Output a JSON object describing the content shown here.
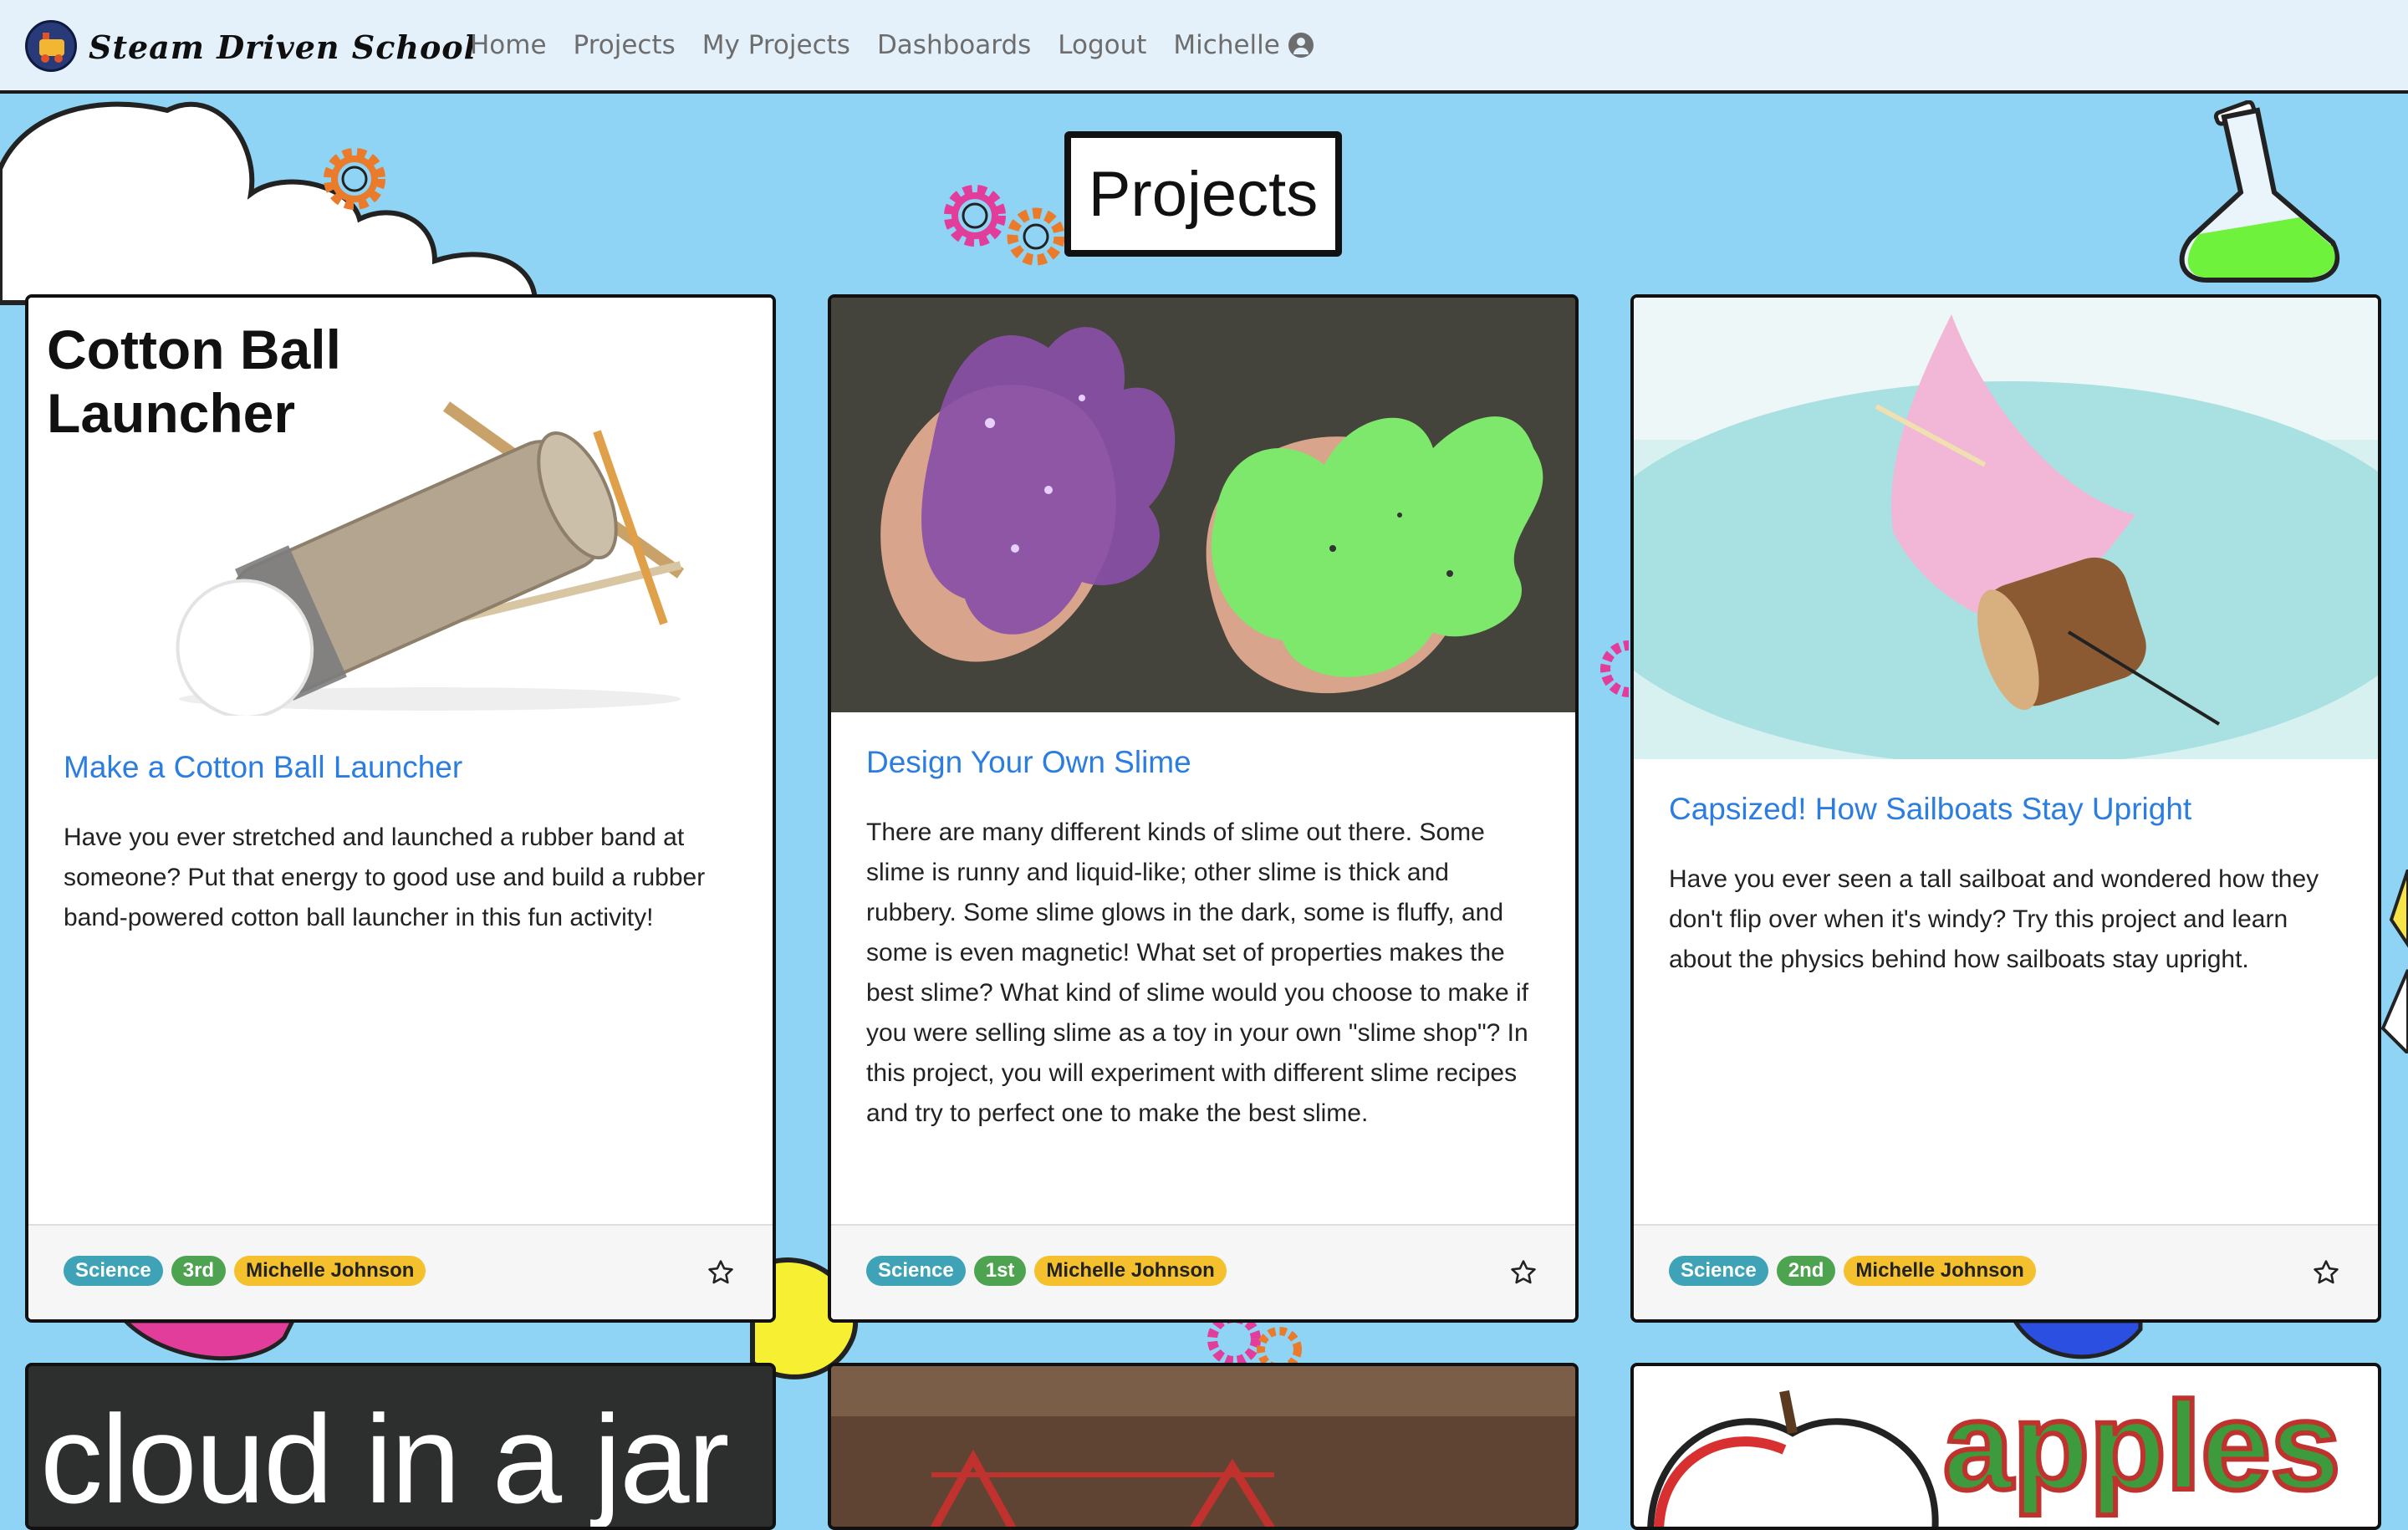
{
  "navbar": {
    "brand": "Steam Driven School",
    "links": [
      "Home",
      "Projects",
      "My Projects",
      "Dashboards",
      "Logout"
    ],
    "user_name": "Michelle",
    "icons": {
      "logo": "train-logo-icon",
      "user": "user-circle-icon"
    }
  },
  "page": {
    "title": "Projects"
  },
  "cards": [
    {
      "image_caption": "Cotton Ball Launcher",
      "title": "Make a Cotton Ball Launcher",
      "description": "Have you ever stretched and launched a rubber band at someone? Put that energy to good use and build a rubber band-powered cotton ball launcher in this fun activity!",
      "subject": "Science",
      "grade": "3rd",
      "author": "Michelle Johnson"
    },
    {
      "title": "Design Your Own Slime",
      "description": "There are many different kinds of slime out there. Some slime is runny and liquid-like; other slime is thick and rubbery. Some slime glows in the dark, some is fluffy, and some is even magnetic! What set of properties makes the best slime? What kind of slime would you choose to make if you were selling slime as a toy in your own \"slime shop\"? In this project, you will experiment with different slime recipes and try to perfect one to make the best slime.",
      "subject": "Science",
      "grade": "1st",
      "author": "Michelle Johnson"
    },
    {
      "title": "Capsized! How Sailboats Stay Upright",
      "description": "Have you ever seen a tall sailboat and wondered how they don't flip over when it's windy? Try this project and learn about the physics behind how sailboats stay upright.",
      "subject": "Science",
      "grade": "2nd",
      "author": "Michelle Johnson"
    }
  ],
  "bottom_cards": [
    {
      "image_caption": "cloud in a jar"
    },
    {
      "image_caption": ""
    },
    {
      "image_caption": "apples"
    }
  ],
  "colors": {
    "background": "#8fd3f5",
    "navbar": "#e4f1fb",
    "link": "#2b7de0",
    "badge_subject": "#3fa3b8",
    "badge_grade": "#4ea351",
    "badge_author": "#f5c02e"
  }
}
